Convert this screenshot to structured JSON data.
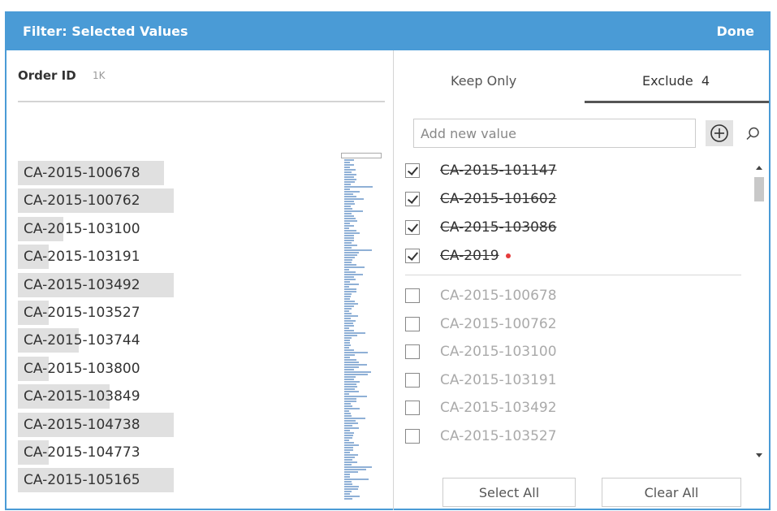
{
  "dialog": {
    "title": "Filter: Selected Values",
    "done_label": "Done",
    "accent_color": "#4a9bd6"
  },
  "field": {
    "name": "Order ID",
    "count": "1K"
  },
  "values": [
    {
      "label": "CA-2015-100678",
      "frequency": 0.94
    },
    {
      "label": "CA-2015-100762",
      "frequency": 1.0
    },
    {
      "label": "CA-2015-103100",
      "frequency": 0.29
    },
    {
      "label": "CA-2015-103191",
      "frequency": 0.2
    },
    {
      "label": "CA-2015-103492",
      "frequency": 1.0
    },
    {
      "label": "CA-2015-103527",
      "frequency": 0.2
    },
    {
      "label": "CA-2015-103744",
      "frequency": 0.39
    },
    {
      "label": "CA-2015-103800",
      "frequency": 0.2
    },
    {
      "label": "CA-2015-103849",
      "frequency": 0.59
    },
    {
      "label": "CA-2015-104738",
      "frequency": 1.0
    },
    {
      "label": "CA-2015-104773",
      "frequency": 0.2
    },
    {
      "label": "CA-2015-105165",
      "frequency": 1.0
    }
  ],
  "tabs": {
    "keep_only": "Keep Only",
    "exclude": "Exclude  4"
  },
  "add_value": {
    "placeholder": "Add new value"
  },
  "excluded_values": [
    {
      "label": "CA-2015-101147",
      "checked": true
    },
    {
      "label": "CA-2015-101602",
      "checked": true
    },
    {
      "label": "CA-2015-103086",
      "checked": true
    },
    {
      "label": "CA-2019",
      "checked": true,
      "new": true
    }
  ],
  "other_values": [
    {
      "label": "CA-2015-100678",
      "checked": false
    },
    {
      "label": "CA-2015-100762",
      "checked": false
    },
    {
      "label": "CA-2015-103100",
      "checked": false
    },
    {
      "label": "CA-2015-103191",
      "checked": false
    },
    {
      "label": "CA-2015-103492",
      "checked": false
    },
    {
      "label": "CA-2015-103527",
      "checked": false
    }
  ],
  "buttons": {
    "select_all": "Select All",
    "clear_all": "Clear All"
  }
}
